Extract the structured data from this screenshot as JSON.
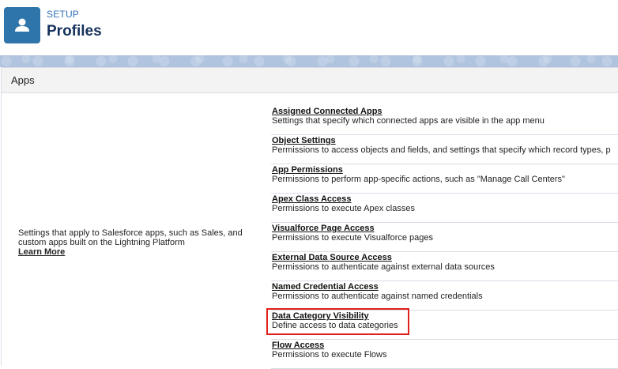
{
  "header": {
    "eyebrow": "SETUP",
    "title": "Profiles",
    "icon": "user-icon",
    "icon_bg": "#2d75aa"
  },
  "section": {
    "title": "Apps",
    "description": "Settings that apply to Salesforce apps, such as Sales, and custom apps built on the Lightning Platform",
    "learn_more": "Learn More"
  },
  "items": [
    {
      "label": "Assigned Connected Apps",
      "description": "Settings that specify which connected apps are visible in the app menu"
    },
    {
      "label": "Object Settings",
      "description": "Permissions to access objects and fields, and settings that specify which record types, p"
    },
    {
      "label": "App Permissions",
      "description": "Permissions to perform app-specific actions, such as \"Manage Call Centers\""
    },
    {
      "label": "Apex Class Access",
      "description": "Permissions to execute Apex classes"
    },
    {
      "label": "Visualforce Page Access",
      "description": "Permissions to execute Visualforce pages"
    },
    {
      "label": "External Data Source Access",
      "description": "Permissions to authenticate against external data sources"
    },
    {
      "label": "Named Credential Access",
      "description": "Permissions to authenticate against named credentials"
    },
    {
      "label": "Data Category Visibility",
      "description": "Define access to data categories"
    },
    {
      "label": "Flow Access",
      "description": "Permissions to execute Flows"
    }
  ],
  "highlight_color": "#e0201b"
}
